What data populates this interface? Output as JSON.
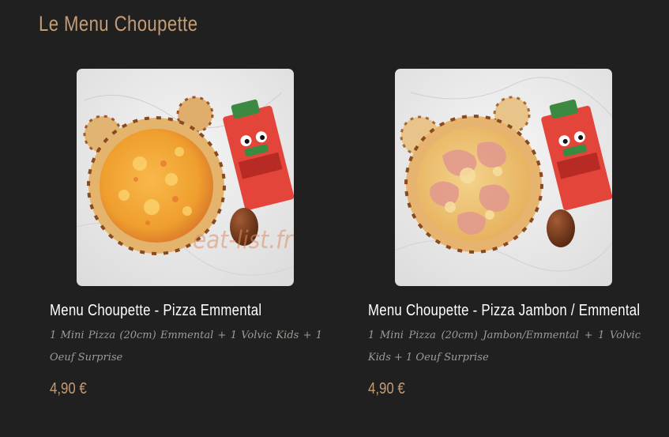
{
  "section": {
    "title": "Le Menu Choupette"
  },
  "items": [
    {
      "name": "Menu Choupette - Pizza Emmental",
      "description": "1 Mini Pizza (20cm) Emmental + 1 Volvic Kids + 1 Oeuf Surprise",
      "price": "4,90 €",
      "image_icon": "pizza-emmental-photo"
    },
    {
      "name": "Menu Choupette - Pizza Jambon / Emmental",
      "description": "1 Mini Pizza (20cm) Jambon/Emmental + 1 Volvic Kids + 1 Oeuf Surprise",
      "price": "4,90 €",
      "image_icon": "pizza-jambon-emmental-photo"
    }
  ],
  "watermark": {
    "text": "eat-list.fr"
  },
  "colors": {
    "background": "#212021",
    "accent": "#c49c74",
    "text": "#ffffff",
    "muted": "#a09a94"
  }
}
